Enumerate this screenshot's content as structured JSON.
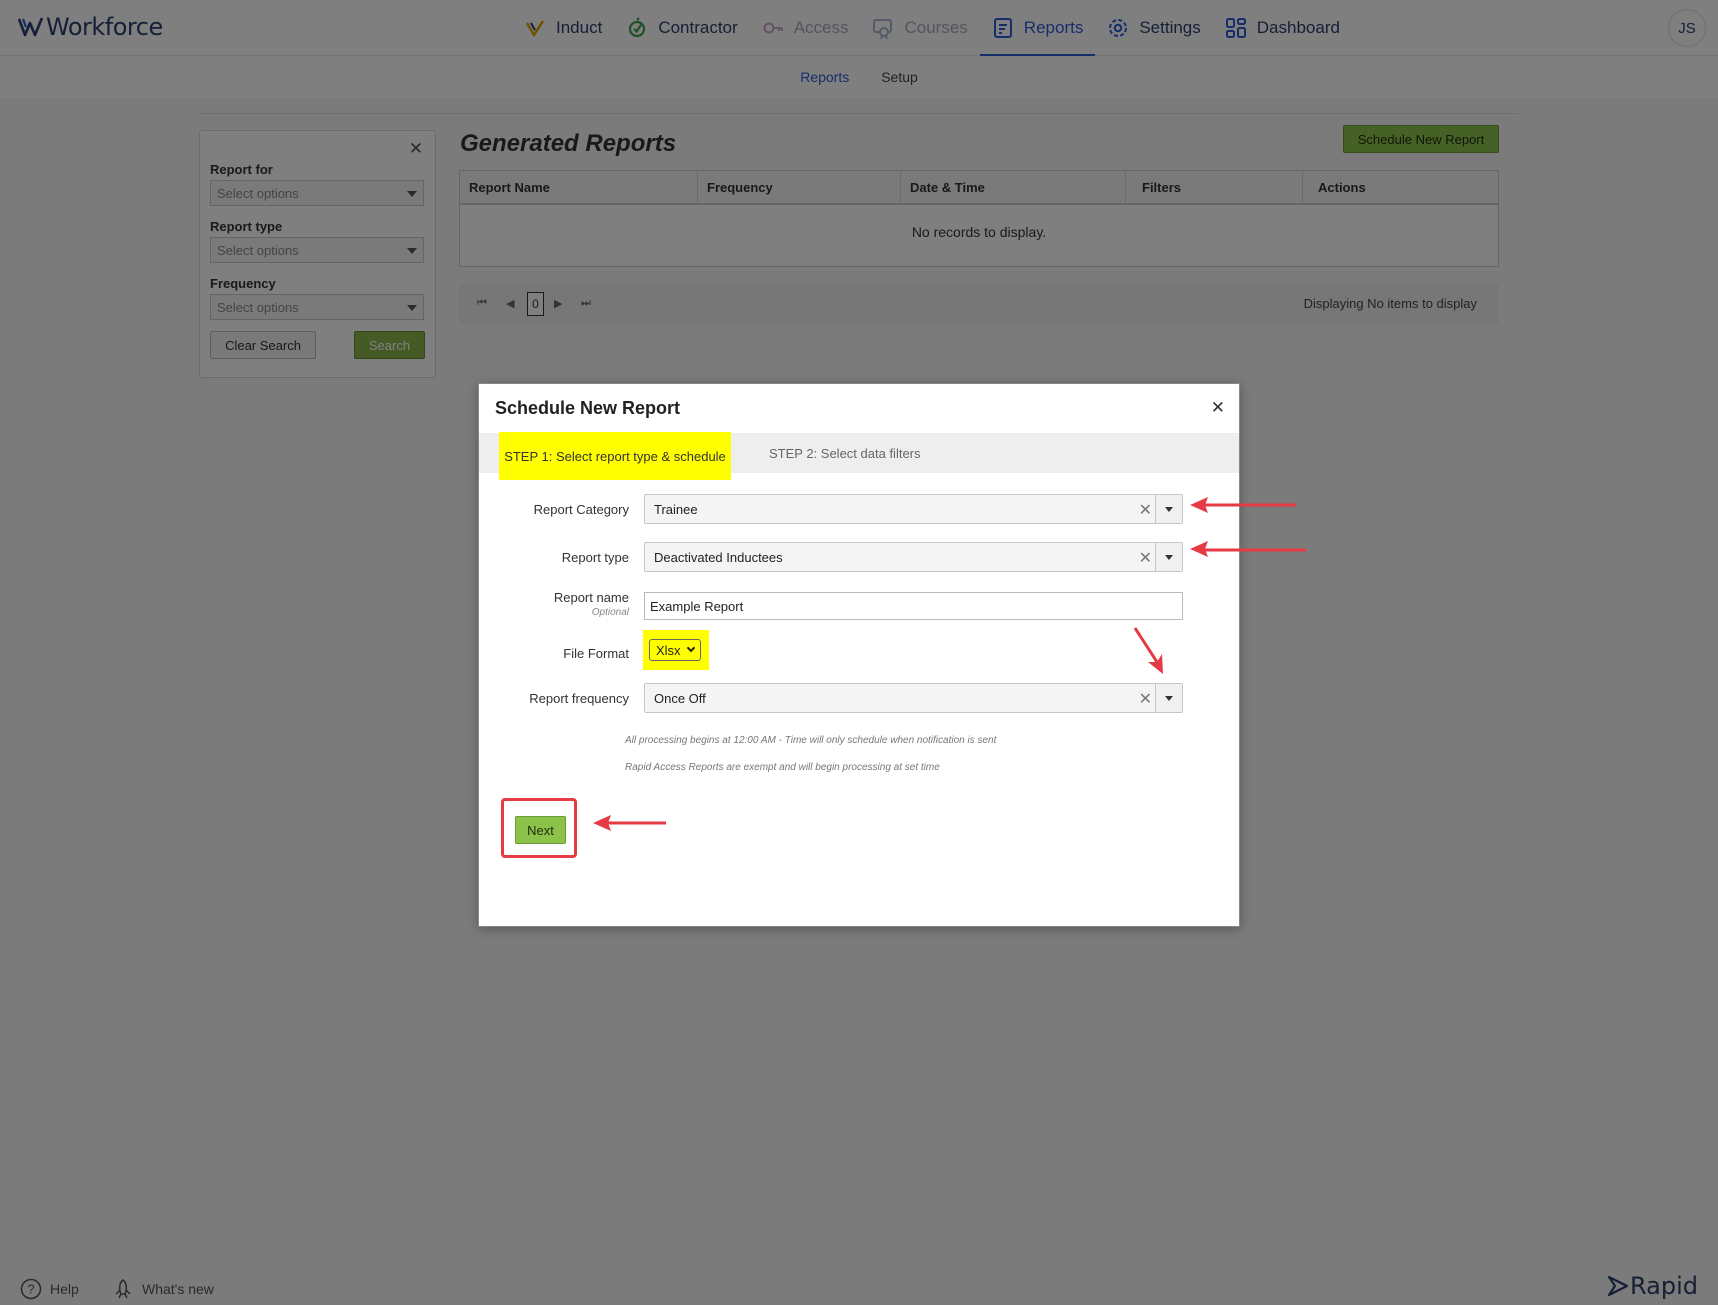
{
  "app": {
    "brand": "Workforce",
    "user_initials": "JS",
    "footer_brand": "Rapid"
  },
  "nav": {
    "items": [
      {
        "label": "Induct",
        "icon": "induct-icon",
        "state": "normal"
      },
      {
        "label": "Contractor",
        "icon": "contractor-icon",
        "state": "normal"
      },
      {
        "label": "Access",
        "icon": "access-icon",
        "state": "disabled"
      },
      {
        "label": "Courses",
        "icon": "courses-icon",
        "state": "disabled"
      },
      {
        "label": "Reports",
        "icon": "reports-icon",
        "state": "active"
      },
      {
        "label": "Settings",
        "icon": "settings-icon",
        "state": "normal"
      },
      {
        "label": "Dashboard",
        "icon": "dashboard-icon",
        "state": "normal"
      }
    ]
  },
  "subnav": {
    "reports": "Reports",
    "setup": "Setup"
  },
  "filters": {
    "report_for_label": "Report for",
    "report_type_label": "Report type",
    "frequency_label": "Frequency",
    "placeholder": "Select options",
    "clear_label": "Clear Search",
    "search_label": "Search"
  },
  "generated": {
    "title": "Generated Reports",
    "schedule_button": "Schedule New Report",
    "columns": [
      "Report Name",
      "Frequency",
      "Date & Time",
      "Filters",
      "Actions"
    ],
    "empty": "No records to display.",
    "page": "0",
    "pager_info": "Displaying No items to display"
  },
  "footer": {
    "help": "Help",
    "whats_new": "What's new"
  },
  "modal": {
    "title": "Schedule New Report",
    "step1": "STEP 1: Select report type & schedule",
    "step2": "STEP 2: Select data filters",
    "category_label": "Report Category",
    "category_value": "Trainee",
    "type_label": "Report type",
    "type_value": "Deactivated Inductees",
    "name_label": "Report name",
    "name_optional": "Optional",
    "name_value": "Example Report",
    "format_label": "File Format",
    "format_value": "Xlsx",
    "frequency_label": "Report frequency",
    "frequency_value": "Once Off",
    "note1": "All processing begins at 12:00 AM - Time will only schedule when notification is sent",
    "note2": "Rapid Access Reports are exempt and will begin processing at set time",
    "next_label": "Next"
  },
  "colors": {
    "brand_navy": "#2b3f6c",
    "active_blue": "#2d5bd7",
    "button_green": "#8bc34a",
    "highlight_yellow": "#ffff00",
    "annotation_red": "#e63a45"
  }
}
